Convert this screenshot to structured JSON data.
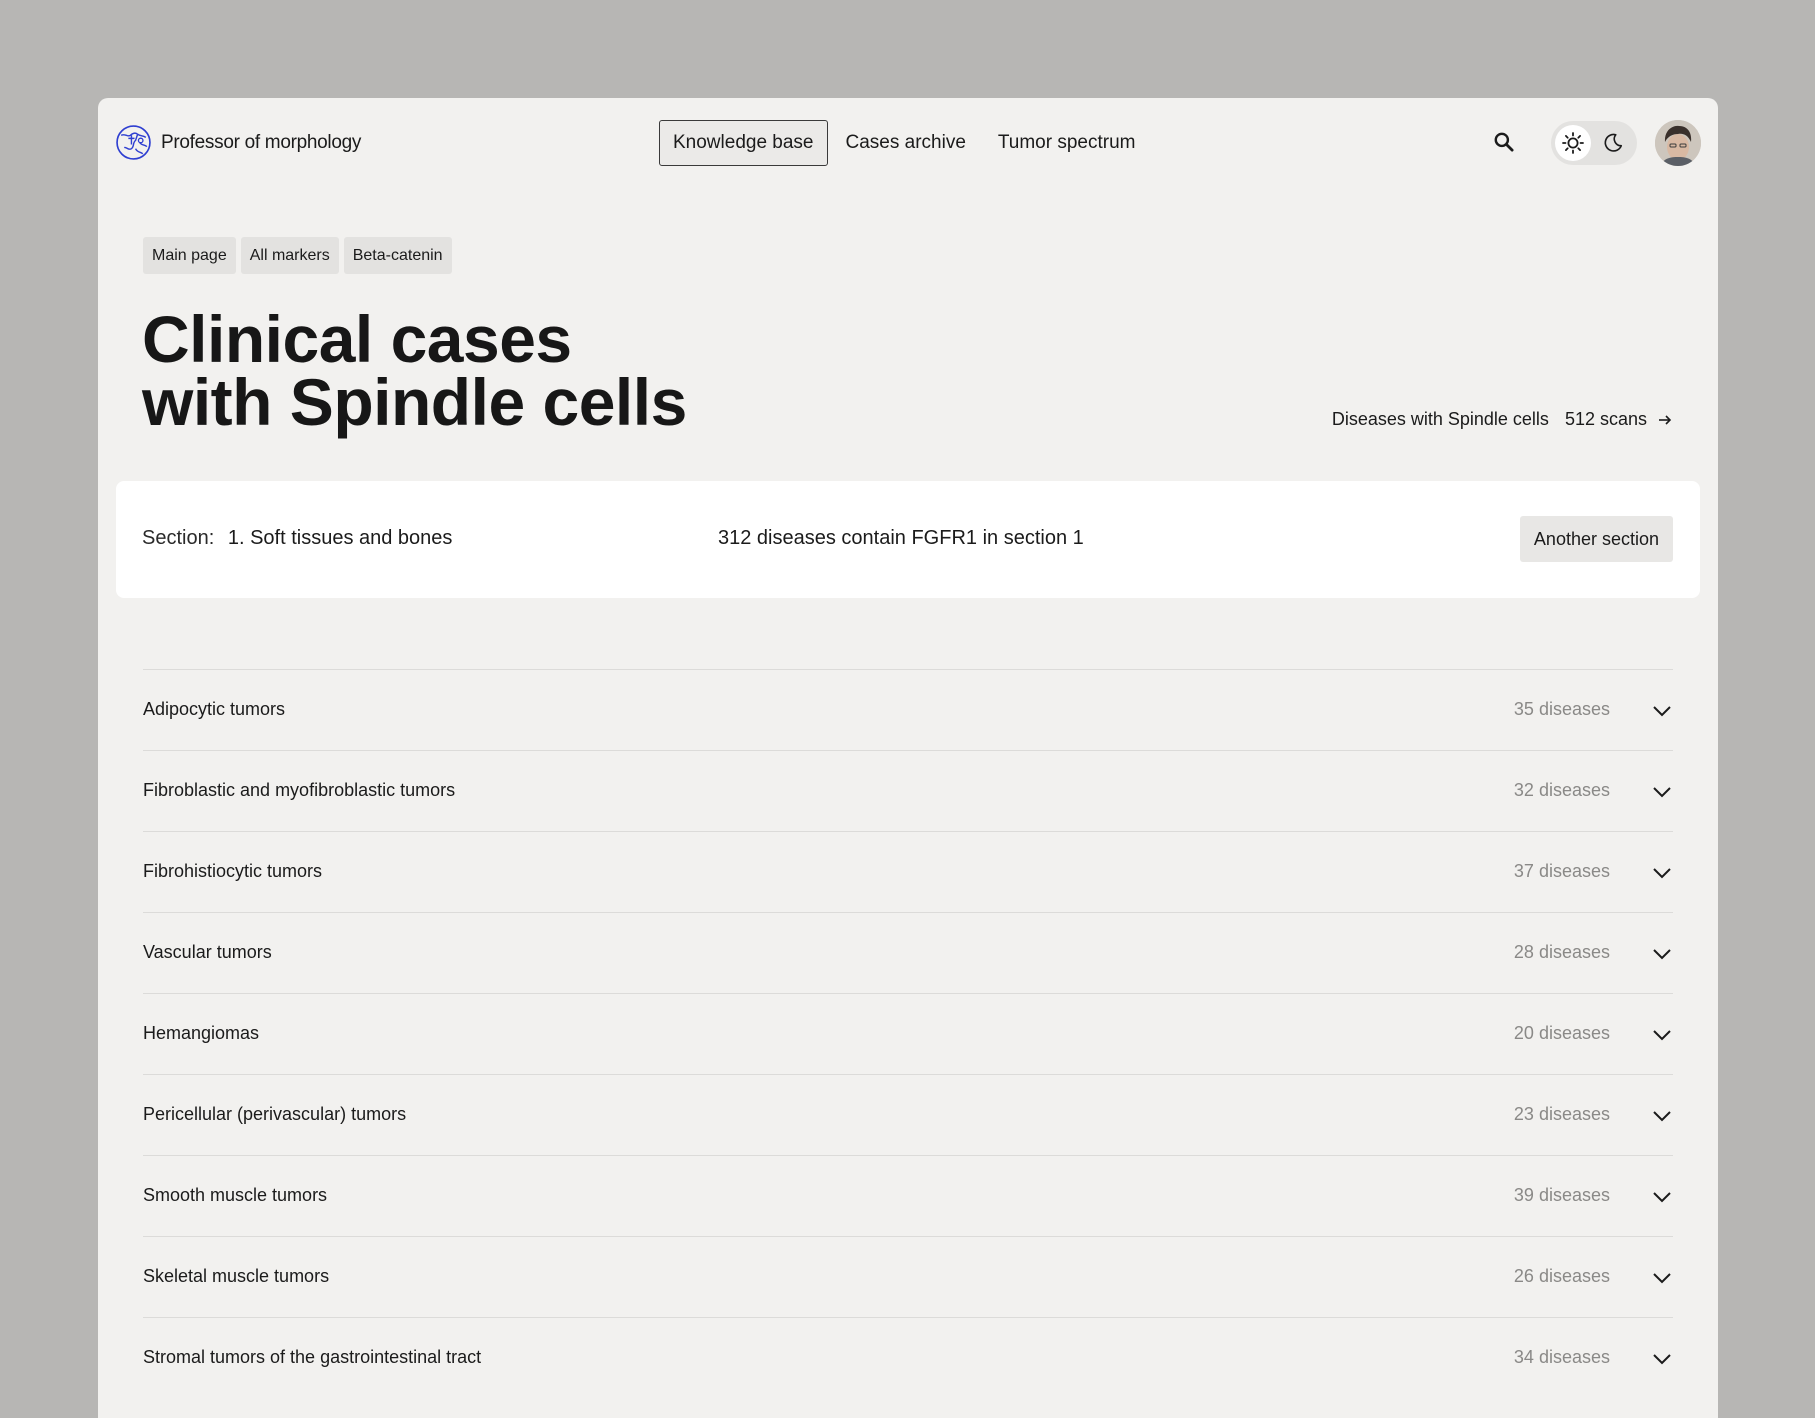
{
  "brand": {
    "name": "Professor of morphology"
  },
  "nav": {
    "items": [
      {
        "label": "Knowledge base",
        "active": true
      },
      {
        "label": "Cases archive",
        "active": false
      },
      {
        "label": "Tumor spectrum",
        "active": false
      }
    ]
  },
  "icons": {
    "search": "search-icon",
    "sun": "sun-icon",
    "moon": "moon-icon",
    "chevron": "chevron-down-icon",
    "arrow": "arrow-right-icon"
  },
  "theme": {
    "selected": "light"
  },
  "breadcrumbs": [
    "Main page",
    "All markers",
    "Beta-catenin"
  ],
  "page": {
    "title_line1": "Clinical cases",
    "title_line2": "with Spindle cells",
    "summary_label": "Diseases with Spindle cells",
    "summary_count": "512 scans"
  },
  "section": {
    "key": "Section:",
    "value": "1. Soft tissues and bones",
    "stat": "312 diseases contain FGFR1 in section 1",
    "button": "Another section"
  },
  "categories": [
    {
      "label": "Adipocytic tumors",
      "count": "35 diseases"
    },
    {
      "label": "Fibroblastic and myofibroblastic tumors",
      "count": "32 diseases"
    },
    {
      "label": "Fibrohistiocytic tumors",
      "count": "37 diseases"
    },
    {
      "label": "Vascular tumors",
      "count": "28 diseases"
    },
    {
      "label": "Hemangiomas",
      "count": "20 diseases"
    },
    {
      "label": "Pericellular (perivascular) tumors",
      "count": "23 diseases"
    },
    {
      "label": "Smooth muscle tumors",
      "count": "39 diseases"
    },
    {
      "label": "Skeletal muscle tumors",
      "count": "26 diseases"
    },
    {
      "label": "Stromal tumors of the gastrointestinal tract",
      "count": "34 diseases"
    }
  ],
  "colors": {
    "brand_blue": "#2f3fd1",
    "background": "#f2f1ef",
    "backdrop": "#b7b6b4",
    "muted_text": "#8a8987"
  }
}
